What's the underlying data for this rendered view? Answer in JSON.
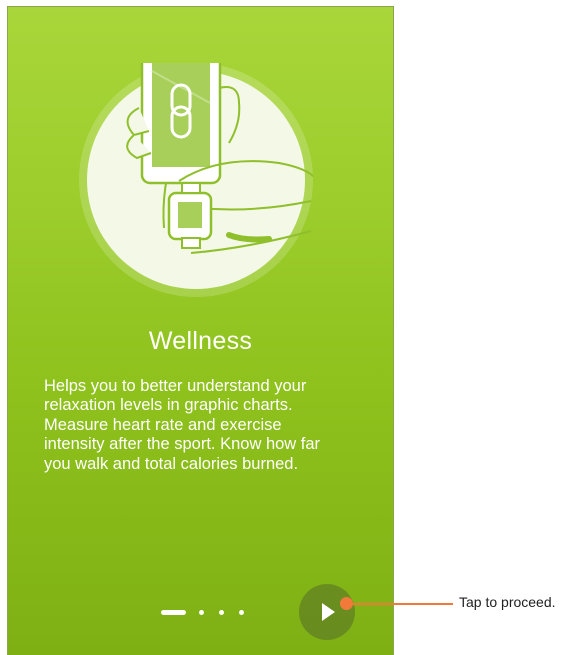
{
  "screen": {
    "title": "Wellness",
    "description": "Helps you to better understand your\nrelaxation levels in graphic charts.\nMeasure heart rate and exercise\nintensity after the sport. Know how far\nyou walk and total calories burned.",
    "background_color": "#9ccd2c",
    "pager": {
      "page_count": 4,
      "current_page": 1
    },
    "next_button": {
      "icon": "play-icon"
    }
  },
  "annotation": {
    "text": "Tap to proceed.",
    "color": "#f07a3a"
  },
  "illustration": {
    "icon": "hand-holding-phone-with-watch-illustration"
  }
}
